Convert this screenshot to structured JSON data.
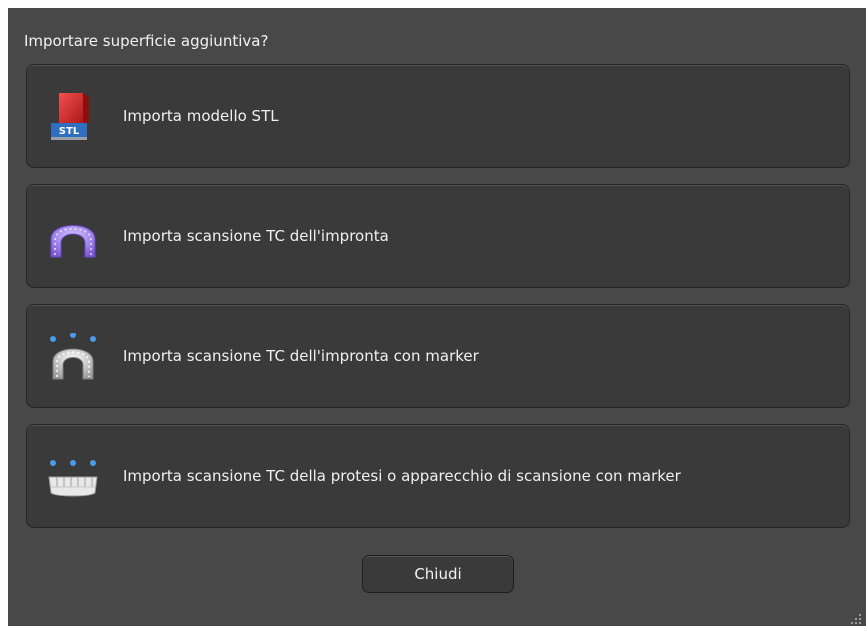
{
  "dialog": {
    "prompt": "Importare superficie aggiuntiva?",
    "options": [
      {
        "label": "Importa modello STL",
        "icon": "stl-model-icon"
      },
      {
        "label": "Importa scansione TC dell'impronta",
        "icon": "impression-scan-icon"
      },
      {
        "label": "Importa scansione TC dell'impronta con marker",
        "icon": "impression-marker-icon"
      },
      {
        "label": "Importa scansione TC della protesi o apparecchio di scansione con marker",
        "icon": "prosthesis-marker-icon"
      }
    ],
    "close_label": "Chiudi",
    "stl_icon_text": "STL"
  },
  "colors": {
    "background": "#484848",
    "button": "#3a3a3a",
    "text": "#f0f0f0",
    "marker": "#4a9be8",
    "impression": "#9a7ee6"
  }
}
